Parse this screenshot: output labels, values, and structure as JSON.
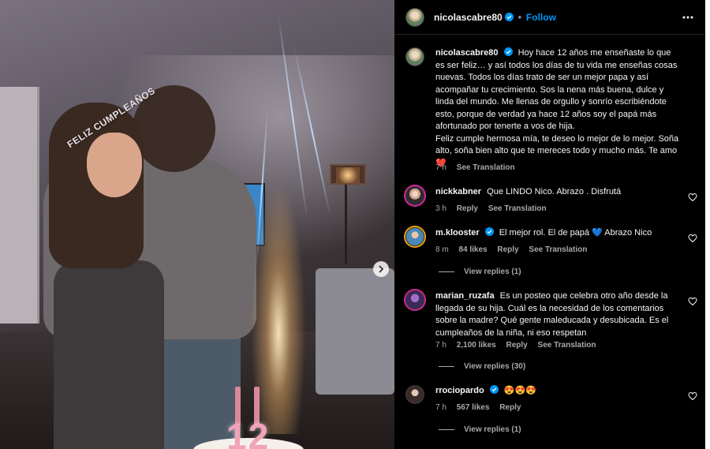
{
  "photo": {
    "crown_text": "FELIZ CUMPLEAÑOS",
    "cake_number": "12"
  },
  "header": {
    "username": "nicolascabre80",
    "separator": "•",
    "follow_label": "Follow"
  },
  "caption": {
    "username": "nicolascabre80",
    "paragraph1": "Hoy hace 12 años me enseñaste lo que es ser feliz… y así todos los días de tu vida me enseñas cosas nuevas. Todos los días trato de ser un mejor papa y así acompañar tu crecimiento. Sos la nena más buena, dulce y linda del mundo. Me llenas de orgullo y sonrío escribiéndote esto, porque de verdad ya hace 12 años soy el papá más afortunado por tenerte a vos de hija.",
    "paragraph2": "Feliz cumple hermosa mía, te deseo lo mejor de lo mejor. Soña alto, soña bien alto que te mereces todo y mucho más. Te amo",
    "emoji": "❤️",
    "time": "7 h",
    "see_translation": "See Translation"
  },
  "comments": [
    {
      "username": "nickkabner",
      "text": "Que LINDO Nico. Abrazo . Disfrutá",
      "time": "3 h",
      "reply": "Reply",
      "see_translation": "See Translation"
    },
    {
      "username": "m.klooster",
      "text_before": "El mejor rol. El de papá",
      "emoji": "💙",
      "text_after": "Abrazo Nico",
      "time": "8 m",
      "likes": "84 likes",
      "reply": "Reply",
      "see_translation": "See Translation",
      "view_replies": "View replies (1)"
    },
    {
      "username": "marian_ruzafa",
      "text": "Es un posteo que celebra otro año desde la llegada de su hija. Cuál es la necesidad de los comentarios sobre la madre? Qué gente maleducada y desubicada. Es el cumpleaños de la niña, ni eso respetan",
      "time": "7 h",
      "likes": "2,100 likes",
      "reply": "Reply",
      "see_translation": "See Translation",
      "view_replies": "View replies (30)"
    },
    {
      "username": "rrociopardo",
      "text": "😍😍😍",
      "time": "7 h",
      "likes": "567 likes",
      "reply": "Reply",
      "view_replies": "View replies (1)"
    }
  ],
  "colors": {
    "accent": "#0095f6",
    "verified": "#0095f6",
    "secondary_text": "#a8a8a8",
    "background": "#000000"
  },
  "icons": {
    "verified": "verified-badge-icon",
    "more": "more-options-icon",
    "heart": "heart-outline-icon",
    "next": "chevron-right-icon"
  }
}
